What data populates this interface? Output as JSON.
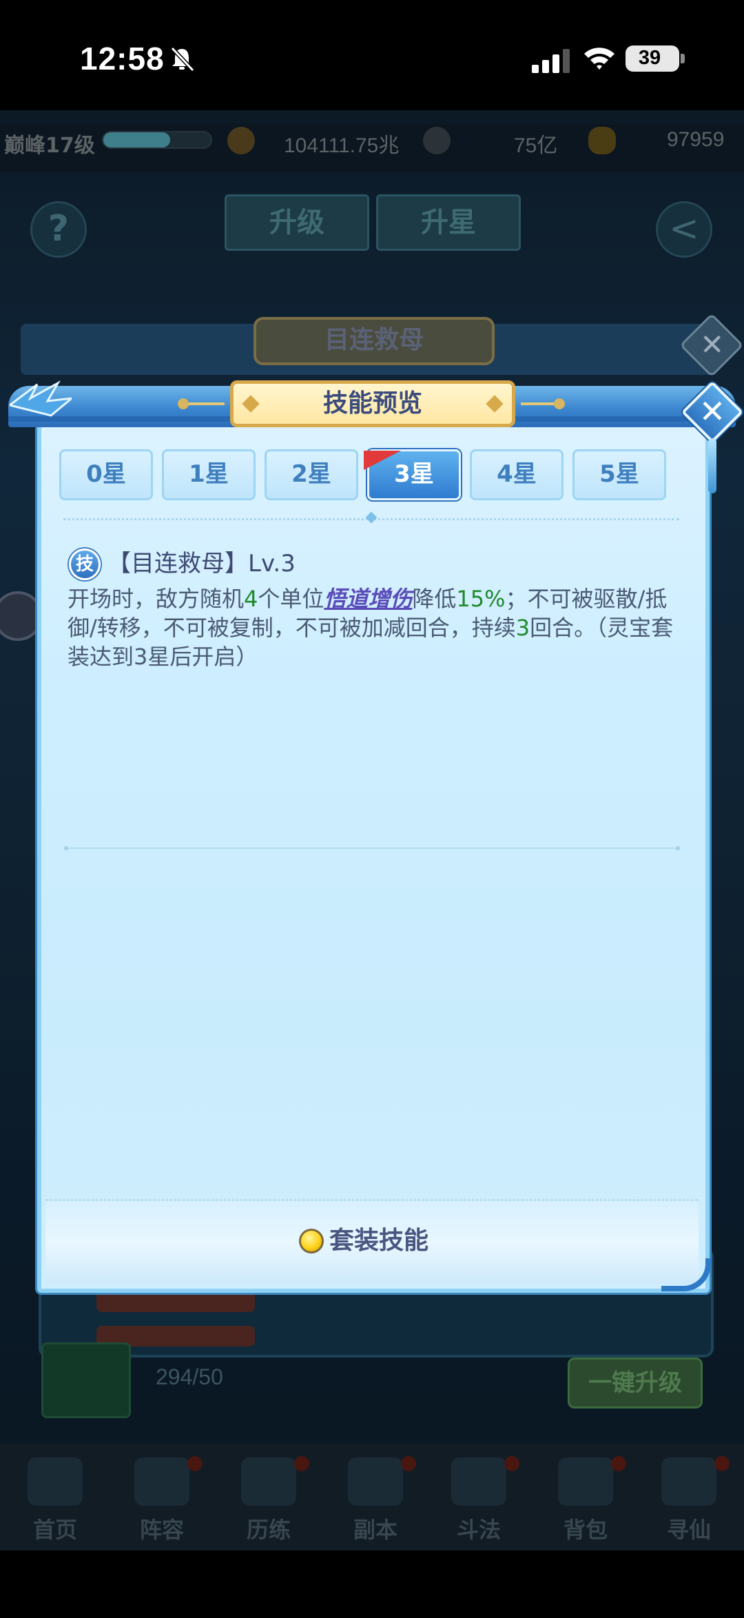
{
  "status_bar": {
    "time": "12:58",
    "battery": "39"
  },
  "game_bg": {
    "realm": "巅峰17级",
    "currency": [
      "104111.75兆",
      "75亿",
      "97959"
    ],
    "exp_fraction": 0.62,
    "tabs": [
      "升级",
      "升星"
    ],
    "help_glyph": "?",
    "back_glyph": "<",
    "progress": "294/50",
    "upgrade_button": "一键升级",
    "nav": [
      "首页",
      "阵容",
      "历练",
      "副本",
      "斗法",
      "背包",
      "寻仙"
    ]
  },
  "outer_popup": {
    "title": "目连救母",
    "close_glyph": "✕"
  },
  "dialog": {
    "title": "技能预览",
    "close_glyph": "✕",
    "tabs": [
      {
        "label": "0星",
        "active": false
      },
      {
        "label": "1星",
        "active": false
      },
      {
        "label": "2星",
        "active": false
      },
      {
        "label": "3星",
        "active": true
      },
      {
        "label": "4星",
        "active": false
      },
      {
        "label": "5星",
        "active": false
      }
    ],
    "skill": {
      "badge": "技",
      "title": "【目连救母】Lv.3",
      "desc_parts": [
        {
          "text": "开场时，敌方随机",
          "style": "plain"
        },
        {
          "text": "4",
          "style": "green"
        },
        {
          "text": "个单位",
          "style": "plain"
        },
        {
          "text": "悟道增伤",
          "style": "link"
        },
        {
          "text": "降低",
          "style": "plain"
        },
        {
          "text": "15%",
          "style": "green"
        },
        {
          "text": "；不可被驱散/抵御/转移，不可被复制，不可被加减回合，持续",
          "style": "plain"
        },
        {
          "text": "3",
          "style": "green"
        },
        {
          "text": "回合。（灵宝套装达到3星后开启）",
          "style": "plain"
        }
      ]
    },
    "footer_label": "套装技能"
  },
  "colors": {
    "accent": "#2f7bd0",
    "highlight_green": "#1f8a2c",
    "link_purple": "#5a4cb8",
    "flag_red": "#e23a3a"
  }
}
